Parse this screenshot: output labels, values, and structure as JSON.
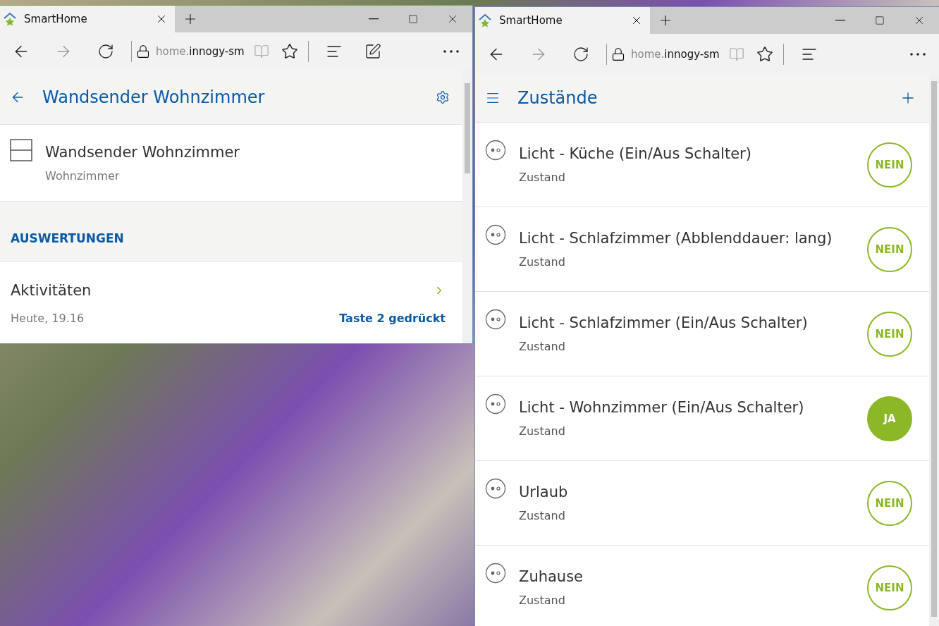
{
  "left_window": {
    "tab": {
      "title": "SmartHome"
    },
    "url_dim": "home.",
    "url": "innogy-sm",
    "header": {
      "title": "Wandsender Wohnzimmer"
    },
    "device": {
      "name": "Wandsender Wohnzimmer",
      "room": "Wohnzimmer"
    },
    "section": {
      "title": "AUSWERTUNGEN"
    },
    "activity": {
      "title": "Aktivitäten",
      "time": "Heute, 19.16",
      "event": "Taste 2 gedrückt"
    }
  },
  "right_window": {
    "tab": {
      "title": "SmartHome"
    },
    "url_dim": "home.",
    "url": "innogy-sm",
    "header": {
      "title": "Zustände"
    },
    "states": [
      {
        "name": "Licht - Küche (Ein/Aus Schalter)",
        "subtitle": "Zustand",
        "value": "NEIN",
        "active": false
      },
      {
        "name": "Licht - Schlafzimmer (Abblenddauer: lang)",
        "subtitle": "Zustand",
        "value": "NEIN",
        "active": false
      },
      {
        "name": "Licht - Schlafzimmer (Ein/Aus Schalter)",
        "subtitle": "Zustand",
        "value": "NEIN",
        "active": false
      },
      {
        "name": "Licht - Wohnzimmer (Ein/Aus Schalter)",
        "subtitle": "Zustand",
        "value": "JA",
        "active": true
      },
      {
        "name": "Urlaub",
        "subtitle": "Zustand",
        "value": "NEIN",
        "active": false
      },
      {
        "name": "Zuhause",
        "subtitle": "Zustand",
        "value": "NEIN",
        "active": false
      }
    ]
  }
}
